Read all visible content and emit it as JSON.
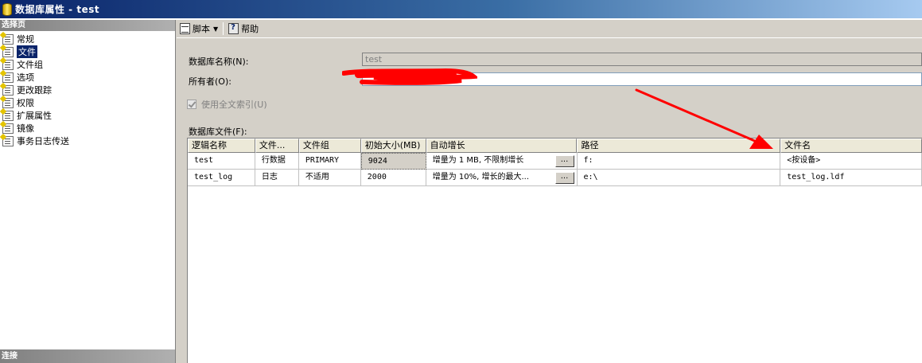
{
  "window": {
    "title": "数据库属性 - test",
    "title_icon": "database-icon"
  },
  "left_pane": {
    "header": "选择页",
    "items": [
      {
        "label": "常规",
        "icon": "page-icon",
        "selected": false
      },
      {
        "label": "文件",
        "icon": "page-icon",
        "selected": true
      },
      {
        "label": "文件组",
        "icon": "page-icon",
        "selected": false
      },
      {
        "label": "选项",
        "icon": "page-icon",
        "selected": false
      },
      {
        "label": "更改跟踪",
        "icon": "page-icon",
        "selected": false
      },
      {
        "label": "权限",
        "icon": "page-icon",
        "selected": false
      },
      {
        "label": "扩展属性",
        "icon": "page-icon",
        "selected": false
      },
      {
        "label": "镜像",
        "icon": "page-icon",
        "selected": false
      },
      {
        "label": "事务日志传送",
        "icon": "page-icon",
        "selected": false
      }
    ],
    "footer": "连接"
  },
  "toolbar": {
    "script_label": "脚本",
    "help_label": "帮助"
  },
  "form": {
    "db_name_label": "数据库名称(N):",
    "db_name_value": "test",
    "owner_label": "所有者(O):",
    "owner_value": "",
    "fulltext_label": "使用全文索引(U)",
    "fulltext_checked": true,
    "db_files_label": "数据库文件(F):"
  },
  "grid": {
    "columns": [
      "逻辑名称",
      "文件...",
      "文件组",
      "初始大小(MB)",
      "自动增长",
      "路径",
      "文件名"
    ],
    "rows": [
      {
        "logical": "test",
        "type": "行数据",
        "filegroup": "PRIMARY",
        "size": "9024",
        "autogrow": "增量为 1 MB, 不限制增长",
        "path": "f:",
        "filename": "<按设备>"
      },
      {
        "logical": "test_log",
        "type": "日志",
        "filegroup": "不适用",
        "size": "2000",
        "autogrow": "增量为 10%, 增长的最大...",
        "path": "e:\\",
        "filename": "test_log.ldf"
      }
    ],
    "ellipsis": "..."
  },
  "colors": {
    "title_bar": "#0a246a",
    "selection": "#0a246a",
    "annotation": "#ff0000"
  }
}
